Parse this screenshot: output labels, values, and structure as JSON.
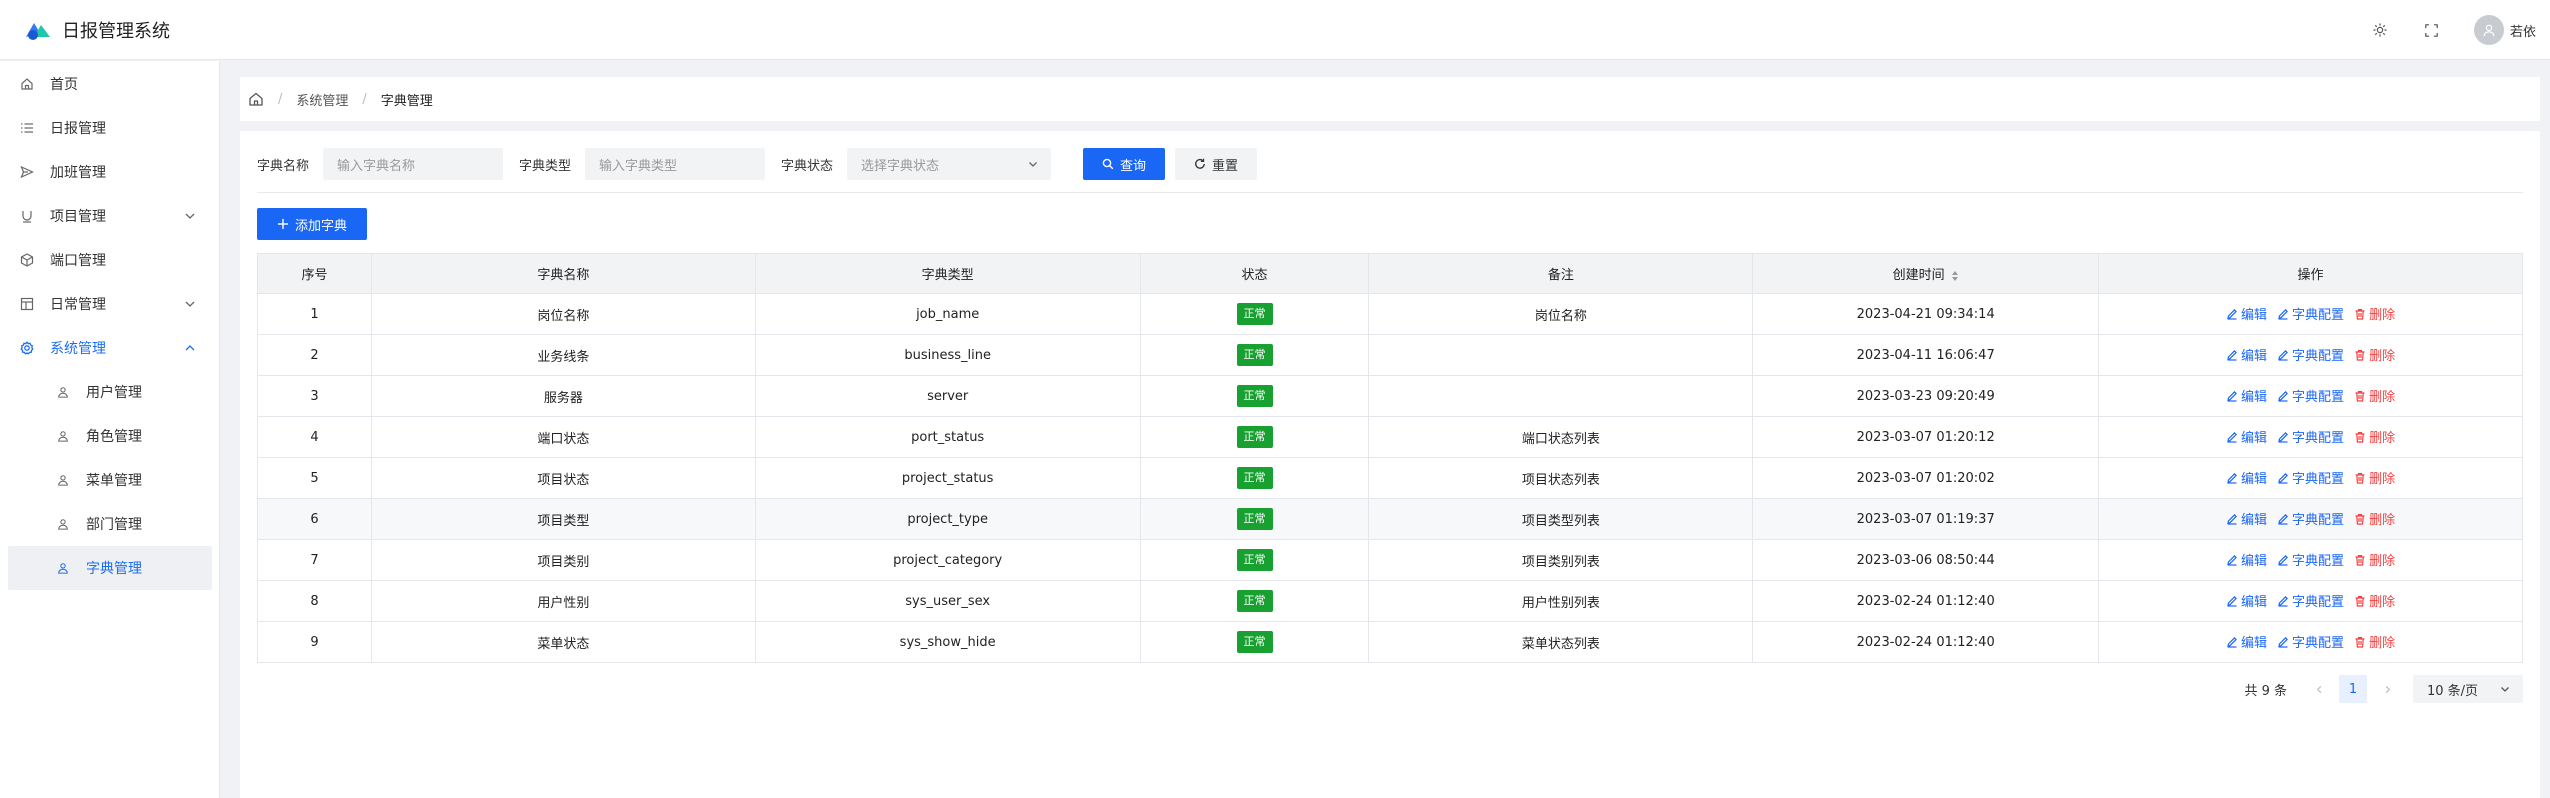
{
  "app": {
    "title": "日报管理系统"
  },
  "header": {
    "username": "若依"
  },
  "sidebar": {
    "items": [
      {
        "label": "首页"
      },
      {
        "label": "日报管理"
      },
      {
        "label": "加班管理"
      },
      {
        "label": "项目管理"
      },
      {
        "label": "端口管理"
      },
      {
        "label": "日常管理"
      },
      {
        "label": "系统管理"
      }
    ],
    "sub_items": [
      {
        "label": "用户管理"
      },
      {
        "label": "角色管理"
      },
      {
        "label": "菜单管理"
      },
      {
        "label": "部门管理"
      },
      {
        "label": "字典管理"
      }
    ]
  },
  "breadcrumb": {
    "level1": "系统管理",
    "level2": "字典管理",
    "separator": "/"
  },
  "filters": {
    "name_label": "字典名称",
    "name_placeholder": "输入字典名称",
    "type_label": "字典类型",
    "type_placeholder": "输入字典类型",
    "status_label": "字典状态",
    "status_placeholder": "选择字典状态",
    "search_label": "查询",
    "reset_label": "重置"
  },
  "actions": {
    "add_label": "添加字典"
  },
  "table": {
    "headers": {
      "index": "序号",
      "name": "字典名称",
      "type": "字典类型",
      "status": "状态",
      "remark": "备注",
      "created": "创建时间",
      "ops": "操作"
    },
    "op_labels": {
      "edit": "编辑",
      "config": "字典配置",
      "delete": "删除"
    },
    "rows": [
      {
        "index": "1",
        "name": "岗位名称",
        "type": "job_name",
        "status": "正常",
        "remark": "岗位名称",
        "created": "2023-04-21 09:34:14"
      },
      {
        "index": "2",
        "name": "业务线条",
        "type": "business_line",
        "status": "正常",
        "remark": "",
        "created": "2023-04-11 16:06:47"
      },
      {
        "index": "3",
        "name": "服务器",
        "type": "server",
        "status": "正常",
        "remark": "",
        "created": "2023-03-23 09:20:49"
      },
      {
        "index": "4",
        "name": "端口状态",
        "type": "port_status",
        "status": "正常",
        "remark": "端口状态列表",
        "created": "2023-03-07 01:20:12"
      },
      {
        "index": "5",
        "name": "项目状态",
        "type": "project_status",
        "status": "正常",
        "remark": "项目状态列表",
        "created": "2023-03-07 01:20:02"
      },
      {
        "index": "6",
        "name": "项目类型",
        "type": "project_type",
        "status": "正常",
        "remark": "项目类型列表",
        "created": "2023-03-07 01:19:37"
      },
      {
        "index": "7",
        "name": "项目类别",
        "type": "project_category",
        "status": "正常",
        "remark": "项目类别列表",
        "created": "2023-03-06 08:50:44"
      },
      {
        "index": "8",
        "name": "用户性别",
        "type": "sys_user_sex",
        "status": "正常",
        "remark": "用户性别列表",
        "created": "2023-02-24 01:12:40"
      },
      {
        "index": "9",
        "name": "菜单状态",
        "type": "sys_show_hide",
        "status": "正常",
        "remark": "菜单状态列表",
        "created": "2023-02-24 01:12:40"
      }
    ]
  },
  "pagination": {
    "total": "共 9 条",
    "current_page": "1",
    "page_size": "10 条/页"
  },
  "colors": {
    "primary": "#1a66f5",
    "success": "#18a130",
    "danger": "#f53f3f"
  }
}
